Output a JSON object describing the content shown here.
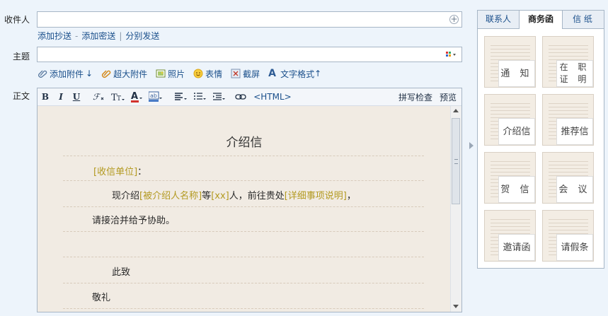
{
  "compose": {
    "recipient_label": "收件人",
    "cc_links": [
      "添加抄送",
      "添加密送",
      "分别发送"
    ],
    "subject_label": "主题",
    "body_label": "正文"
  },
  "attach_bar": {
    "add_attachment": "添加附件",
    "add_attachment_arrow": "↓",
    "large_attachment": "超大附件",
    "photo": "照片",
    "emoji": "表情",
    "screenshot": "截屏",
    "text_format": "文字格式",
    "text_format_arrow": "↑"
  },
  "toolbar": {
    "bold": "B",
    "italic": "I",
    "underline": "U",
    "font": "T",
    "html": "<HTML>",
    "spellcheck": "拼写检查",
    "preview": "预览"
  },
  "letter": {
    "title": "介绍信",
    "recipient_placeholder": "[收信单位]",
    "recipient_suffix": "：",
    "line2_prefix": "现介绍",
    "line2_ph1": "[被介绍人名称]",
    "line2_mid1": "等",
    "line2_ph2": "[xx]",
    "line2_mid2": "人，前往贵处",
    "line2_ph3": "[详细事项说明]",
    "line2_suffix": "，",
    "line3": "请接洽并给予协助。",
    "closing1": "此致",
    "closing2": "敬礼"
  },
  "right_panel": {
    "tabs": [
      "联系人",
      "商务函",
      "信 纸"
    ],
    "active_tab": "商务函",
    "templates": [
      "通 知",
      "在 职 证 明",
      "介绍信",
      "推荐信",
      "贺 信",
      "会 议",
      "邀请函",
      "请假条"
    ]
  },
  "colors": {
    "link": "#1a4f8b",
    "placeholder": "#b39a21",
    "paper": "#f1ebe3"
  }
}
